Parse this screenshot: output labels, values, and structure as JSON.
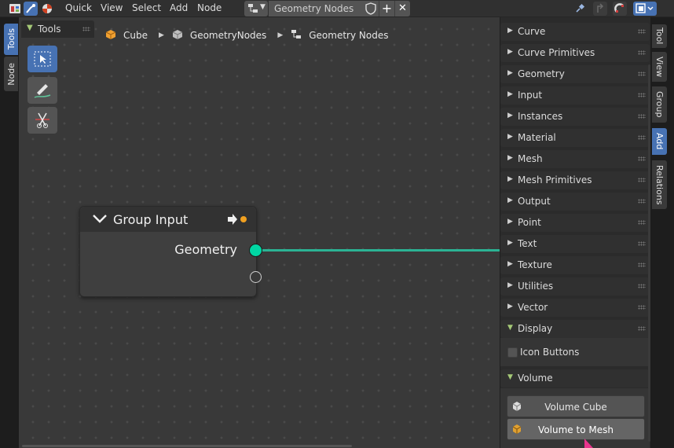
{
  "header": {
    "menus": [
      "Quick",
      "View",
      "Select",
      "Add",
      "Node"
    ],
    "tree_name": "Geometry Nodes",
    "icons": [
      "editor-type-icon",
      "geometry-nodes-context-icon",
      "material-context-icon",
      "node-tree-icon",
      "fake-user-shield-icon",
      "new-plus-icon",
      "unlink-x-icon",
      "pin-icon",
      "parent-up-icon",
      "snap-icon",
      "overlay-icon"
    ]
  },
  "left_tabs": [
    "Tools",
    "Node"
  ],
  "tools_panel": {
    "title": "Tools"
  },
  "breadcrumb": [
    "Cube",
    "GeometryNodes",
    "Geometry Nodes"
  ],
  "node": {
    "title": "Group Input",
    "output_label": "Geometry"
  },
  "sidebar": {
    "categories": [
      "Curve",
      "Curve Primitives",
      "Geometry",
      "Input",
      "Instances",
      "Material",
      "Mesh",
      "Mesh Primitives",
      "Output",
      "Point",
      "Text",
      "Texture",
      "Utilities",
      "Vector"
    ],
    "display_panel": {
      "title": "Display",
      "checkbox_label": "Icon Buttons",
      "checked": false
    },
    "volume_panel": {
      "title": "Volume",
      "buttons": [
        "Volume Cube",
        "Volume to Mesh"
      ]
    }
  },
  "right_tabs": [
    "Tool",
    "View",
    "Group",
    "Add",
    "Relations"
  ],
  "active_right_tab": "Add",
  "colors": {
    "accent": "#4772b3",
    "socket_geometry": "#00d6a3",
    "link": "#2bb394",
    "panel_open_arrow": "#a5c977",
    "cursor": "#e8348c"
  }
}
